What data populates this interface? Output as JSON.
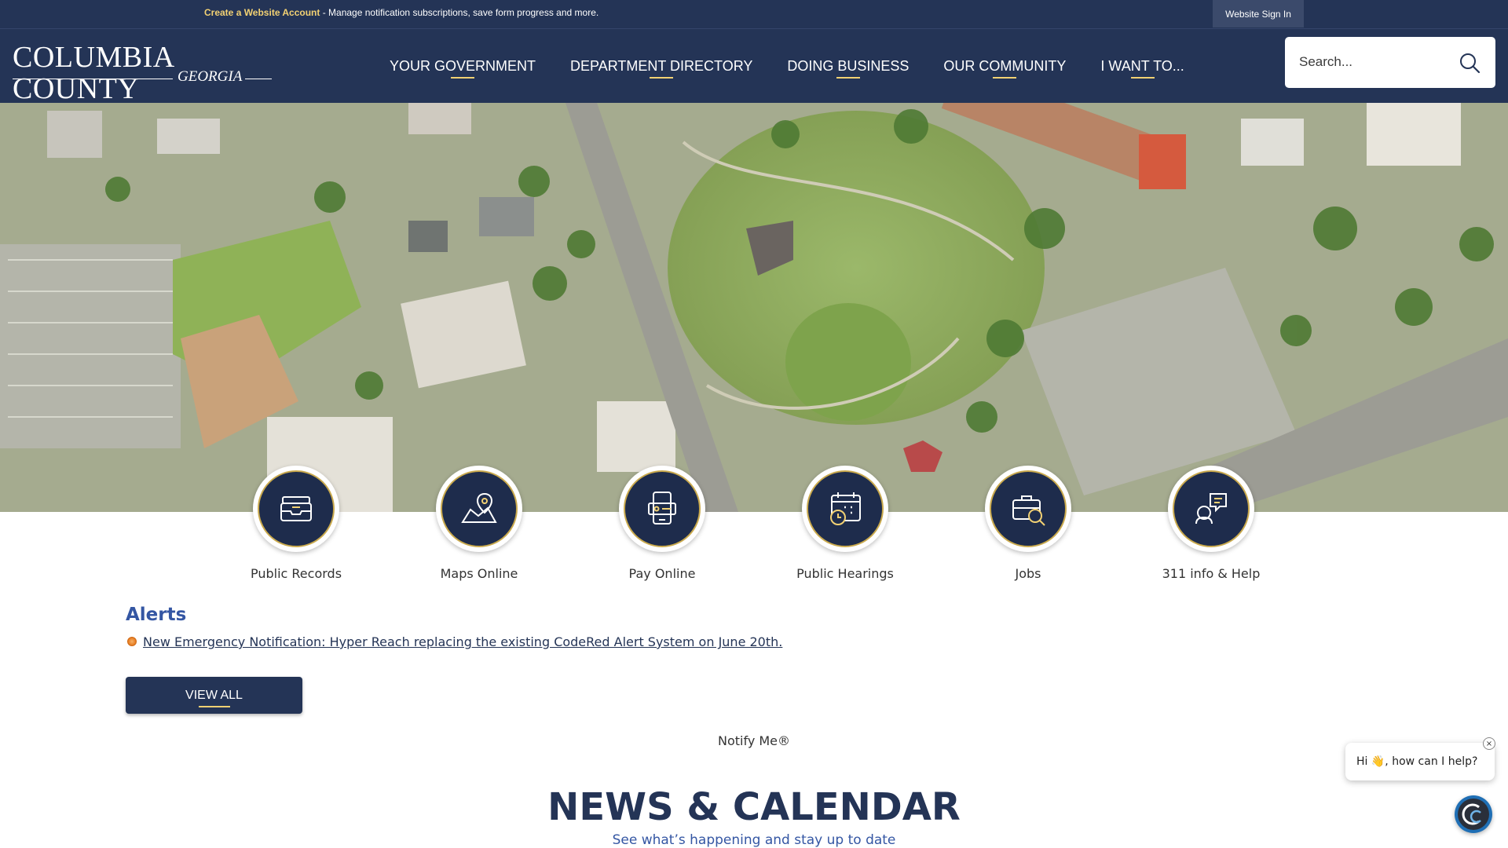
{
  "topbar": {
    "account_link": "Create a Website Account",
    "account_text": " - Manage notification subscriptions, save form progress and more.",
    "signin_label": "Website Sign In"
  },
  "logo": {
    "main": "COLUMBIA COUNTY",
    "sub": "GEORGIA"
  },
  "nav": {
    "items": [
      {
        "label": "YOUR GOVERNMENT"
      },
      {
        "label": "DEPARTMENT DIRECTORY"
      },
      {
        "label": "DOING BUSINESS"
      },
      {
        "label": "OUR COMMUNITY"
      },
      {
        "label": "I WANT TO..."
      }
    ]
  },
  "search": {
    "placeholder": "Search..."
  },
  "quick_links": [
    {
      "label": "Public Records",
      "icon": "archive-box-icon"
    },
    {
      "label": "Maps Online",
      "icon": "map-pin-icon"
    },
    {
      "label": "Pay Online",
      "icon": "payment-device-icon"
    },
    {
      "label": "Public Hearings",
      "icon": "calendar-clock-icon"
    },
    {
      "label": "Jobs",
      "icon": "briefcase-search-icon"
    },
    {
      "label": "311 info & Help",
      "icon": "help-chat-icon"
    }
  ],
  "alerts": {
    "title": "Alerts",
    "items": [
      {
        "text": "New Emergency Notification: Hyper Reach replacing the existing CodeRed Alert System on June 20th."
      }
    ],
    "view_all": "VIEW ALL",
    "notify": "Notify Me®"
  },
  "news": {
    "title": "NEWS & CALENDAR",
    "subtitle": "See what’s happening and stay up to date"
  },
  "chat": {
    "greeting": "Hi 👋, how can I help?",
    "close": "×"
  },
  "colors": {
    "navy": "#243456",
    "gold": "#f2d173",
    "link_blue": "#3456a3",
    "chat_blue": "#1f6fb5"
  }
}
